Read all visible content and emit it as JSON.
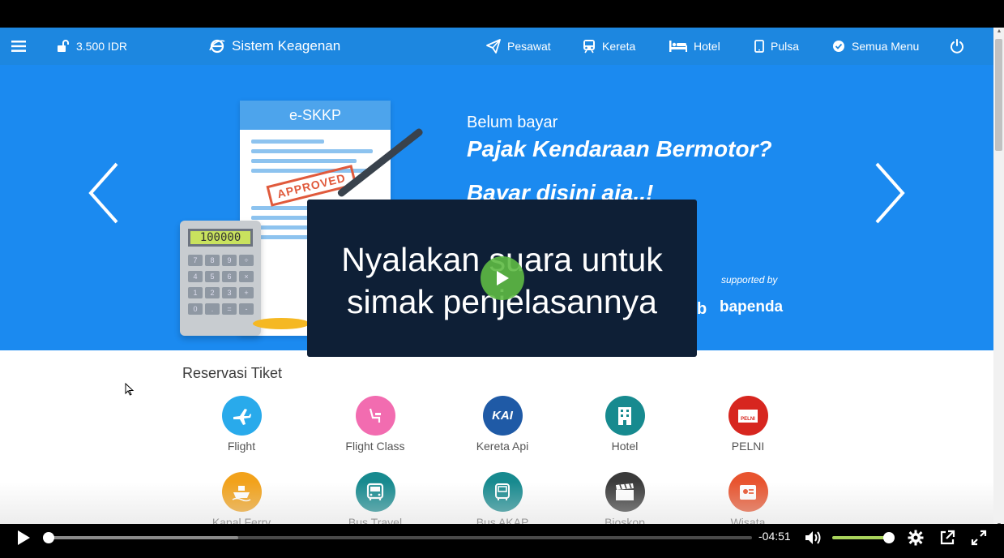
{
  "nav": {
    "balance": "3.500 IDR",
    "brand": "Sistem Keagenan",
    "items": [
      {
        "label": "Pesawat",
        "icon": "paper-plane-icon"
      },
      {
        "label": "Kereta",
        "icon": "train-icon"
      },
      {
        "label": "Hotel",
        "icon": "bed-icon"
      },
      {
        "label": "Pulsa",
        "icon": "mobile-icon"
      },
      {
        "label": "Semua Menu",
        "icon": "check-circle-icon"
      }
    ]
  },
  "banner": {
    "doc_title": "e-SKKP",
    "stamp": "APPROVED",
    "calc_display": "100000",
    "calc_keys": [
      "7",
      "8",
      "9",
      "÷",
      "4",
      "5",
      "6",
      "×",
      "1",
      "2",
      "3",
      "+",
      "0",
      ".",
      "=",
      "-"
    ],
    "line1": "Belum bayar",
    "line2": "Pajak Kendaraan Bermotor?",
    "line3": "Bayar disini aja..!",
    "supported_by": "supported by",
    "partner_b": "b",
    "partner": "bapenda"
  },
  "overlay": {
    "line1": "Nyalakan suara untuk",
    "line2": "simak penjelasannya"
  },
  "reservasi": {
    "title": "Reservasi Tiket",
    "items": [
      {
        "label": "Flight",
        "color": "#29aaeb"
      },
      {
        "label": "Flight Class",
        "color": "#f26cb0"
      },
      {
        "label": "Kereta Api",
        "color": "#1f5aa6"
      },
      {
        "label": "Hotel",
        "color": "#178a8f"
      },
      {
        "label": "PELNI",
        "color": "#d7261f"
      },
      {
        "label": "Kapal Ferry",
        "color": "#f2a21b"
      },
      {
        "label": "Bus Travel",
        "color": "#178a8f"
      },
      {
        "label": "Bus AKAP",
        "color": "#178a8f"
      },
      {
        "label": "Bioskop",
        "color": "#3b3b3b"
      },
      {
        "label": "Wisata",
        "color": "#e8542f"
      }
    ],
    "kai_text": "KAI",
    "pelni_text": "PELNI"
  },
  "video": {
    "time_remaining": "-04:51",
    "progress_fraction": 0.0,
    "buffered_fraction": 0.27,
    "volume_fraction": 1.0
  }
}
